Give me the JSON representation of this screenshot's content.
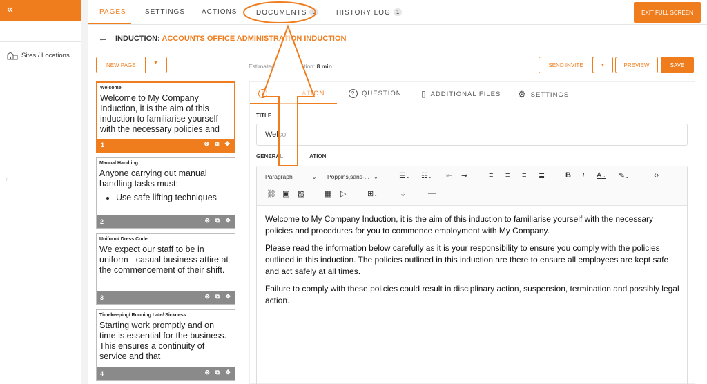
{
  "colors": {
    "accent": "#f07d1d",
    "card_footer": "#8a8a8a"
  },
  "rail": {
    "toggle_icon": "«",
    "items": [
      {
        "label": "Sites / Locations",
        "icon": "sites-icon"
      }
    ]
  },
  "topbar": {
    "tabs": [
      {
        "label": "PAGES",
        "active": true
      },
      {
        "label": "SETTINGS"
      },
      {
        "label": "ACTIONS"
      },
      {
        "label": "DOCUMENTS",
        "badge": "0"
      },
      {
        "label": "HISTORY LOG",
        "badge": "1"
      }
    ],
    "exit_label": "EXIT FULL SCREEN"
  },
  "breadcrumb": {
    "prefix": "INDUCTION:",
    "name": "ACCOUNTS OFFICE ADMINISTRATION INDUCTION"
  },
  "toolbar": {
    "new_page": "NEW PAGE",
    "send_invite": "SEND INVITE",
    "preview": "PREVIEW",
    "save": "SAVE"
  },
  "estimate": {
    "label": "Estimated",
    "label_tail": "tion:",
    "value": "8 min"
  },
  "pages": [
    {
      "title": "Welcome",
      "body": "Welcome to My Company  Induction, it is the aim of this induction to familiarise yourself with the necessary policies and",
      "number": "1"
    },
    {
      "title": "Manual Handling",
      "body": "Anyone carrying out manual handling tasks must:",
      "bullet": "Use safe lifting techniques",
      "number": "2"
    },
    {
      "title": "Uniform/ Dress Code",
      "body": "We expect our staff to be in uniform - casual business attire at the commencement of their shift.",
      "number": "3"
    },
    {
      "title": "Timekeeping/ Running Late/ Sickness",
      "body": "Starting work promptly and on time is essential for the business. This ensures a continuity of service and that",
      "number": "4"
    }
  ],
  "editor_tabs": [
    {
      "label": "ATION",
      "icon": "info-icon",
      "active": true
    },
    {
      "label": "QUESTION",
      "icon": "question-icon"
    },
    {
      "label": "ADDITIONAL FILES",
      "icon": "file-icon"
    },
    {
      "label": "SETTINGS",
      "icon": "gear-icon"
    }
  ],
  "form": {
    "title_label": "TITLE",
    "title_value": "Welco",
    "general_label": "GENERAL",
    "general_label_tail": "ATION"
  },
  "rte": {
    "block_format": "Paragraph",
    "font": "Poppins,sans-...",
    "paragraphs": [
      "Welcome to My Company  Induction, it is the aim of this induction to familiarise yourself with the necessary policies and procedures for you to commence employment with My Company.",
      "Please read the information below carefully as it is your responsibility to ensure you comply with the policies outlined in this induction. The policies outlined in this induction are there to ensure all employees are kept safe and act safely at all times.",
      "Failure to comply with these policies could result in disciplinary action, suspension, termination and possibly legal action."
    ]
  }
}
